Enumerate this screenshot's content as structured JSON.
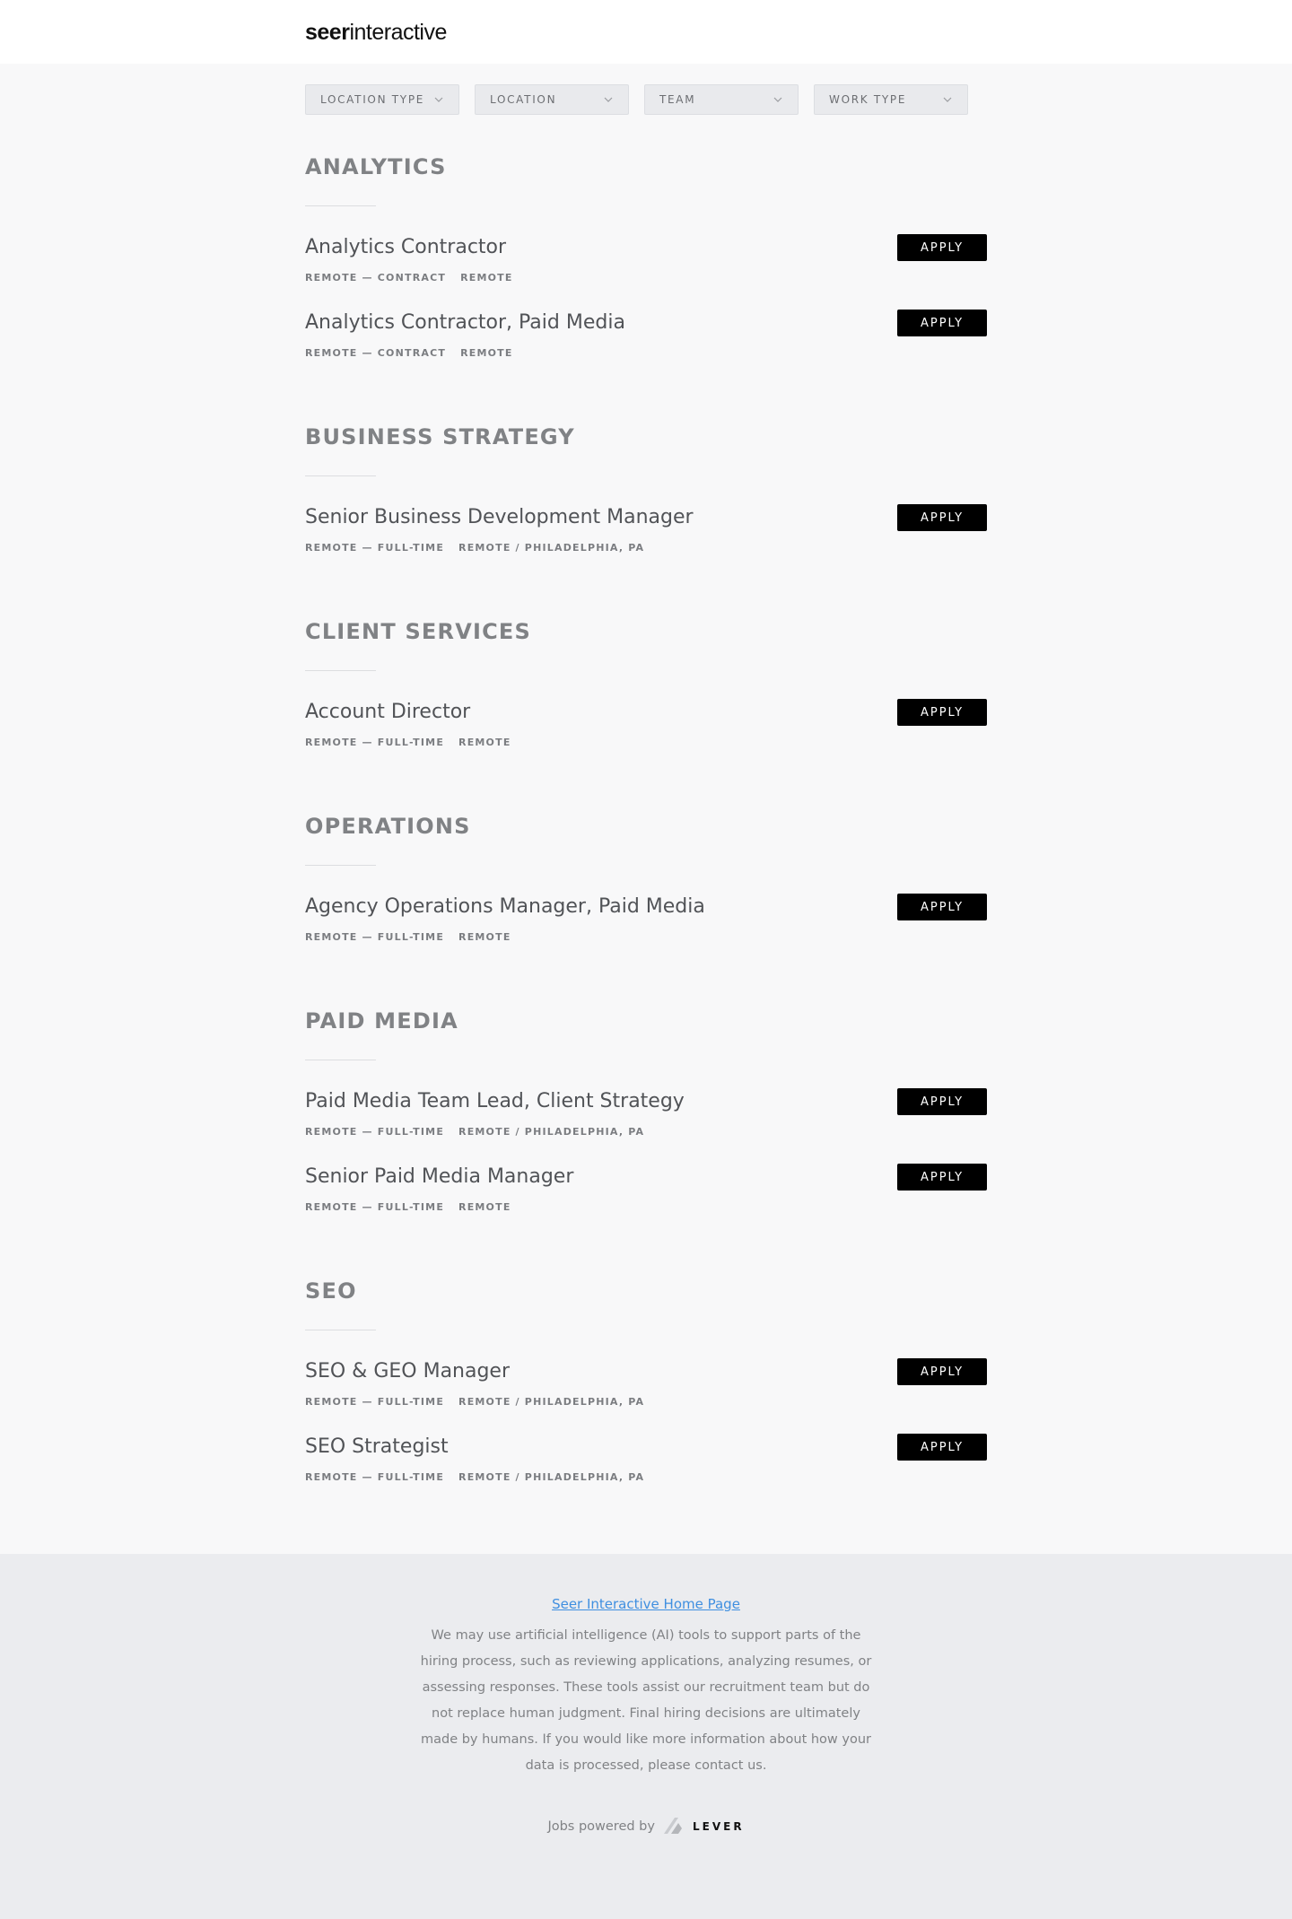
{
  "header": {
    "logo_bold": "seer",
    "logo_light": "interactive"
  },
  "filters": [
    {
      "label": "LOCATION TYPE"
    },
    {
      "label": "LOCATION"
    },
    {
      "label": "TEAM"
    },
    {
      "label": "WORK TYPE"
    }
  ],
  "apply_label": "APPLY",
  "sections": [
    {
      "title": "ANALYTICS",
      "postings": [
        {
          "title": "Analytics Contractor",
          "commitment": "REMOTE — CONTRACT",
          "location": "REMOTE"
        },
        {
          "title": "Analytics Contractor, Paid Media",
          "commitment": "REMOTE — CONTRACT",
          "location": "REMOTE"
        }
      ]
    },
    {
      "title": "BUSINESS STRATEGY",
      "postings": [
        {
          "title": "Senior Business Development Manager",
          "commitment": "REMOTE — FULL-TIME",
          "location": "REMOTE / PHILADELPHIA, PA"
        }
      ]
    },
    {
      "title": "CLIENT SERVICES",
      "postings": [
        {
          "title": "Account Director",
          "commitment": "REMOTE — FULL-TIME",
          "location": "REMOTE"
        }
      ]
    },
    {
      "title": "OPERATIONS",
      "postings": [
        {
          "title": "Agency Operations Manager, Paid Media",
          "commitment": "REMOTE — FULL-TIME",
          "location": "REMOTE"
        }
      ]
    },
    {
      "title": "PAID MEDIA",
      "postings": [
        {
          "title": "Paid Media Team Lead, Client Strategy",
          "commitment": "REMOTE — FULL-TIME",
          "location": "REMOTE / PHILADELPHIA, PA"
        },
        {
          "title": "Senior Paid Media Manager",
          "commitment": "REMOTE — FULL-TIME",
          "location": "REMOTE"
        }
      ]
    },
    {
      "title": "SEO",
      "postings": [
        {
          "title": "SEO & GEO Manager",
          "commitment": "REMOTE — FULL-TIME",
          "location": "REMOTE / PHILADELPHIA, PA"
        },
        {
          "title": "SEO Strategist",
          "commitment": "REMOTE — FULL-TIME",
          "location": "REMOTE / PHILADELPHIA, PA"
        }
      ]
    }
  ],
  "footer": {
    "home_link": "Seer Interactive Home Page",
    "disclaimer": "We may use artificial intelligence (AI) tools to support parts of the hiring process, such as reviewing applications, analyzing resumes, or assessing responses. These tools assist our recruitment team but do not replace human judgment. Final hiring decisions are ultimately made by humans. If you would like more information about how your data is processed, please contact us.",
    "powered_by": "Jobs powered by",
    "lever_word": "LEVER"
  },
  "colors": {
    "accent_link": "#3f8fe0",
    "apply_bg": "#000000",
    "page_bg": "#f8f8f9",
    "footer_bg": "#ebecef"
  },
  "icons": {
    "filter_dropdown": "chevron-down-icon",
    "lever_logo": "lever-logo-icon"
  }
}
